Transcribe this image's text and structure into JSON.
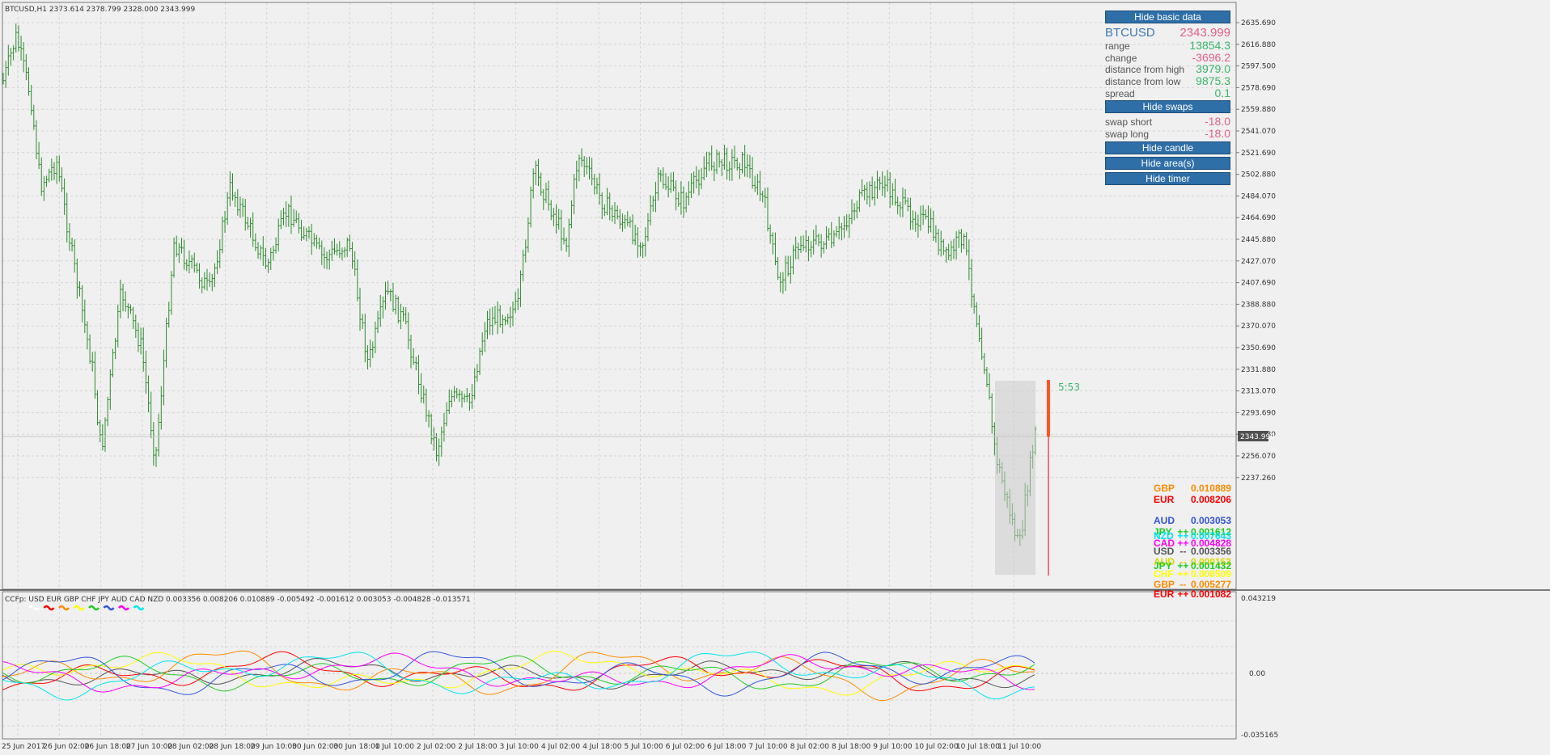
{
  "chart": {
    "info": "BTCUSD,H1  2373.614 2378.799 2328.000 2343.999",
    "price_axis": [
      "2635.690",
      "2616.880",
      "2597.500",
      "2578.690",
      "2559.880",
      "2541.070",
      "2521.690",
      "2502.880",
      "2484.070",
      "2464.690",
      "2445.880",
      "2427.070",
      "2407.690",
      "2388.880",
      "2370.070",
      "2350.690",
      "2331.880",
      "2313.070",
      "2293.690",
      "2274.880",
      "2256.070",
      "2237.260"
    ],
    "current_price": "2343.999",
    "timer": "5:53",
    "time_axis": [
      "25 Jun 2017",
      "26 Jun 02:00",
      "26 Jun 18:00",
      "27 Jun 10:00",
      "28 Jun 02:00",
      "28 Jun 18:00",
      "29 Jun 10:00",
      "30 Jun 02:00",
      "30 Jun 18:00",
      "1 Jul 10:00",
      "2 Jul 02:00",
      "2 Jul 18:00",
      "3 Jul 10:00",
      "4 Jul 02:00",
      "4 Jul 18:00",
      "5 Jul 10:00",
      "6 Jul 02:00",
      "6 Jul 18:00",
      "7 Jul 10:00",
      "8 Jul 02:00",
      "8 Jul 18:00",
      "9 Jul 10:00",
      "10 Jul 02:00",
      "10 Jul 18:00",
      "11 Jul 10:00"
    ],
    "bar_color": "#2e8b2e"
  },
  "panel": {
    "hide_basic_label": "Hide basic data",
    "symbol": "BTCUSD",
    "bid": "2343.999",
    "rows": [
      {
        "label": "range",
        "value": "13854.3",
        "tone": "pos"
      },
      {
        "label": "change",
        "value": "-3696.2",
        "tone": "neg"
      },
      {
        "label": "distance from high",
        "value": "3979.0",
        "tone": "pos"
      },
      {
        "label": "distance from low",
        "value": "9875.3",
        "tone": "pos"
      },
      {
        "label": "spread",
        "value": "0.1",
        "tone": "pos"
      }
    ],
    "hide_swaps_label": "Hide swaps",
    "swaps": [
      {
        "label": "swap short",
        "value": "-18.0",
        "tone": "neg"
      },
      {
        "label": "swap long",
        "value": "-18.0",
        "tone": "neg"
      }
    ],
    "hide_candle_label": "Hide candle",
    "hide_areas_label": "Hide area(s)",
    "hide_timer_label": "Hide timer"
  },
  "indicator": {
    "header": "CCFp:  USD EUR GBP CHF JPY AUD CAD NZD 0.003356 0.008206 0.010889 -0.005492 -0.001612 0.003053 -0.004828 -0.013571",
    "currencies": [
      "USD",
      "EUR",
      "GBP",
      "CHF",
      "JPY",
      "AUD",
      "CAD",
      "NZD"
    ],
    "colors": {
      "USD": "#ffffff",
      "EUR": "#ff0000",
      "GBP": "#ff8c00",
      "CHF": "#ffff00",
      "JPY": "#22cc22",
      "AUD": "#3355dd",
      "CAD": "#ff00ff",
      "NZD": "#00e5ee"
    },
    "axis": [
      "0.043219",
      "0.00",
      "-0.035165"
    ],
    "legend": [
      {
        "cur": "GBP",
        "arrow": "",
        "value": "0.010889",
        "color": "#ff8c00"
      },
      {
        "cur": "EUR",
        "arrow": "",
        "value": "0.008206",
        "color": "#ff0000"
      },
      {
        "cur": "AUD",
        "arrow": "",
        "value": "0.003053",
        "color": "#3355dd"
      },
      {
        "cur": "JPY",
        "arrow": "++",
        "value": "0.001612",
        "color": "#22cc22"
      },
      {
        "cur": "NZD",
        "arrow": "++",
        "value": "0.007643",
        "color": "#00e5ee"
      },
      {
        "cur": "CAD",
        "arrow": "++",
        "value": "0.004828",
        "color": "#ff00ff"
      },
      {
        "cur": "USD",
        "arrow": "--",
        "value": "0.003356",
        "color": "#555555"
      },
      {
        "cur": "AUD",
        "arrow": "--",
        "value": "0.000153",
        "color": "#d9d900"
      },
      {
        "cur": "JPY",
        "arrow": "++",
        "value": "0.001432",
        "color": "#22cc22"
      },
      {
        "cur": "CHF",
        "arrow": "++",
        "value": "0.000509",
        "color": "#ffff00"
      },
      {
        "cur": "GBP",
        "arrow": "--",
        "value": "0.005277",
        "color": "#ff8c00"
      },
      {
        "cur": "EUR",
        "arrow": "++",
        "value": "0.001082",
        "color": "#ff0000"
      }
    ]
  }
}
